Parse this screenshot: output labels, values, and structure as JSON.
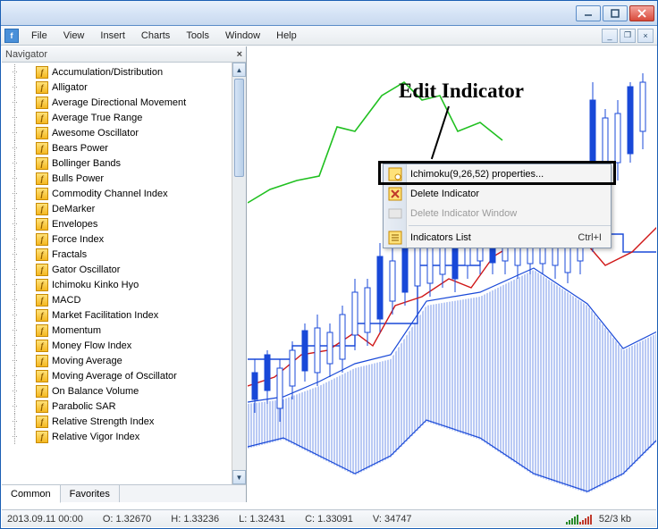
{
  "menubar": {
    "items": [
      "File",
      "View",
      "Insert",
      "Charts",
      "Tools",
      "Window",
      "Help"
    ]
  },
  "navigator": {
    "title": "Navigator",
    "tabs": {
      "common": "Common",
      "favorites": "Favorites"
    },
    "indicators": [
      "Accumulation/Distribution",
      "Alligator",
      "Average Directional Movement",
      "Average True Range",
      "Awesome Oscillator",
      "Bears Power",
      "Bollinger Bands",
      "Bulls Power",
      "Commodity Channel Index",
      "DeMarker",
      "Envelopes",
      "Force Index",
      "Fractals",
      "Gator Oscillator",
      "Ichimoku Kinko Hyo",
      "MACD",
      "Market Facilitation Index",
      "Momentum",
      "Money Flow Index",
      "Moving Average",
      "Moving Average of Oscillator",
      "On Balance Volume",
      "Parabolic SAR",
      "Relative Strength Index",
      "Relative Vigor Index"
    ]
  },
  "context_menu": {
    "properties": "Ichimoku(9,26,52) properties...",
    "delete_indicator": "Delete Indicator",
    "delete_window": "Delete Indicator Window",
    "indicators_list": "Indicators List",
    "indicators_list_shortcut": "Ctrl+I"
  },
  "annotation": {
    "label": "Edit Indicator"
  },
  "statusbar": {
    "datetime": "2013.09.11 00:00",
    "open": "O: 1.32670",
    "high": "H: 1.33236",
    "low": "L: 1.32431",
    "close": "C: 1.33091",
    "volume": "V: 34747",
    "traffic": "52/3 kb"
  },
  "chart_data": {
    "type": "candlestick-ichimoku",
    "indicator": "Ichimoku Kinko Hyo",
    "params": {
      "tenkan": 9,
      "kijun": 26,
      "senkou_b": 52
    },
    "lines": {
      "chikou_span_color": "#20c020",
      "tenkan_sen_color": "#d01818",
      "kijun_sen_color": "#1848d8",
      "senkou_a_color": "#1848d8",
      "senkou_b_color": "#1848d8",
      "kumo_fill": "vertical-hatch-blue"
    },
    "candle_colors": {
      "bull": "#1848d8",
      "bear": "#ffffff",
      "outline": "#1848d8"
    }
  }
}
